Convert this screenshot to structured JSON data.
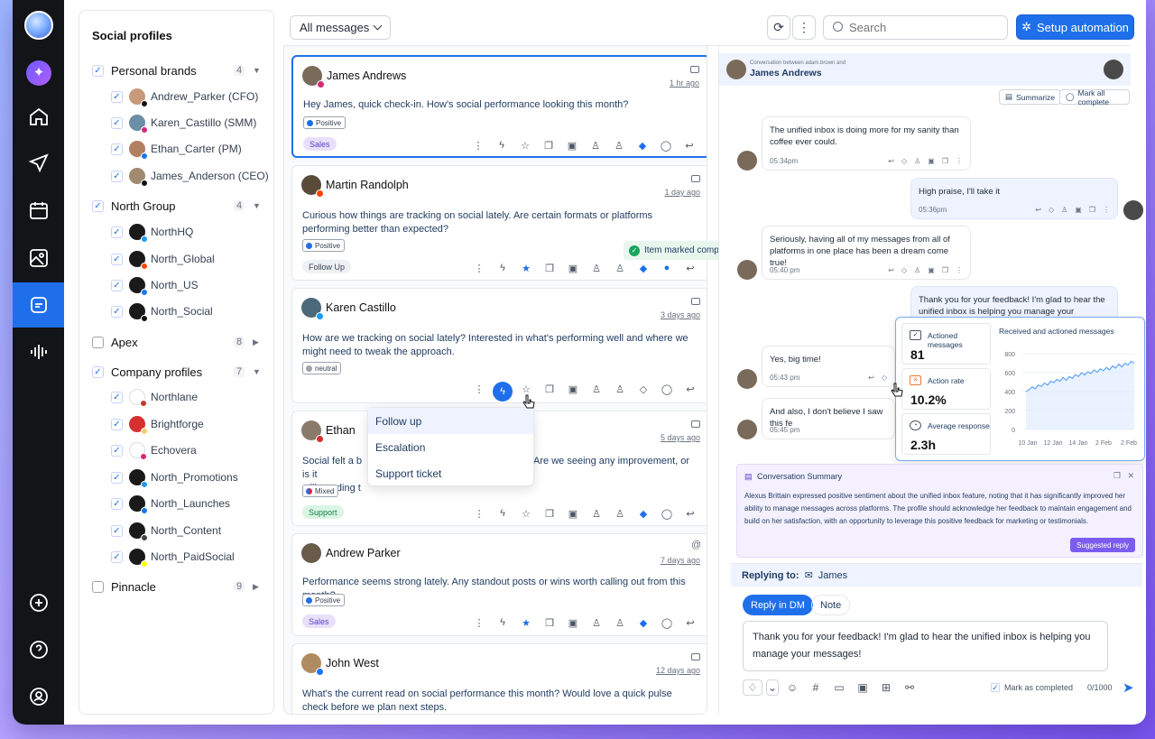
{
  "rail": {
    "nav": [
      "ai-assistant",
      "home",
      "publish",
      "calendar",
      "media",
      "inbox",
      "listening"
    ],
    "active": "inbox",
    "bottom": [
      "add",
      "help",
      "profile"
    ]
  },
  "sidebar": {
    "title": "Social profiles",
    "groups": [
      {
        "name": "Personal brands",
        "count": "4",
        "checked": true,
        "expanded": true,
        "accounts": [
          "Andrew_Parker (CFO)",
          "Karen_Castillo (SMM)",
          "Ethan_Carter (PM)",
          "James_Anderson (CEO)"
        ]
      },
      {
        "name": "North Group",
        "count": "4",
        "checked": true,
        "expanded": true,
        "accounts": [
          "NorthHQ",
          "North_Global",
          "North_US",
          "North_Social"
        ]
      },
      {
        "name": "Apex",
        "count": "8",
        "checked": false,
        "expanded": false,
        "accounts": []
      },
      {
        "name": "Company profiles",
        "count": "7",
        "checked": true,
        "expanded": true,
        "accounts": [
          "Northlane",
          "Brightforge",
          "Echovera",
          "North_Promotions",
          "North_Launches",
          "North_Content",
          "North_PaidSocial"
        ]
      },
      {
        "name": "Pinnacle",
        "count": "9",
        "checked": false,
        "expanded": false,
        "accounts": []
      }
    ]
  },
  "toolbar": {
    "filter": "All messages",
    "search_placeholder": "Search",
    "automation": "Setup automation"
  },
  "messages": [
    {
      "name": "James Andrews",
      "time": "1 hr ago",
      "text": "Hey James, quick check-in. How's social performance looking this month?",
      "sentiment": "Positive",
      "tag": "Sales"
    },
    {
      "name": "Martin Randolph",
      "time": "1 day ago",
      "text": "Curious how things are tracking on social lately. Are certain formats or platforms performing better than expected?",
      "sentiment": "Positive",
      "tag": "Follow Up"
    },
    {
      "name": "Karen Castillo",
      "time": "3 days ago",
      "text": "How are we tracking on social lately? Interested in what's performing well and where we might need to tweak the approach.",
      "sentiment": "neutral",
      "tag": ""
    },
    {
      "name": "Ethan",
      "time": "5 days ago",
      "text": "Social felt a b... Are we seeing any improvement, or is it still trending t...",
      "text_a": "Social felt a b",
      "text_b": "Are we seeing any improvement, or is it",
      "text_c": "still trending t",
      "sentiment": "Mixed",
      "tag": "Support"
    },
    {
      "name": "Andrew Parker",
      "time": "7 days ago",
      "text": "Performance seems strong lately. Any standout posts or wins worth calling out from this month?",
      "sentiment": "Positive",
      "tag": "Sales"
    },
    {
      "name": "John West",
      "time": "12 days ago",
      "text": "What's the current read on social performance this month? Would love a quick pulse check before we plan next steps.",
      "sentiment": "",
      "tag": ""
    }
  ],
  "toast": "Item marked completed",
  "menu": [
    "Follow up",
    "Escalation",
    "Support ticket"
  ],
  "conversation": {
    "header_sub": "Conversation between adam.brown and",
    "header_name": "James Andrews",
    "summarize": "Summarize",
    "mark_all": "Mark all complete",
    "bubbles": [
      {
        "text": "The unified inbox is doing more for my sanity than coffee ever could.",
        "time": "05:34pm",
        "me": false
      },
      {
        "text": "High praise, I'll take it",
        "time": "05:36pm",
        "me": true
      },
      {
        "text": "Seriously, having all of my messages from all of platforms in one place has been a dream come true!",
        "time": "05:40 pm",
        "me": false
      },
      {
        "text": "Thank you for your feedback! I'm glad to hear the unified inbox is helping you manage your messages!",
        "time": "",
        "me": true
      },
      {
        "text": "Yes, big time!",
        "time": "05:43 pm",
        "me": false
      },
      {
        "text": "And also, I don't believe I saw this fe",
        "time": "05:45 pm",
        "me": false
      }
    ]
  },
  "stats": {
    "cards": [
      {
        "label": "Actioned messages",
        "value": "81"
      },
      {
        "label": "Action rate",
        "value": "10.2%"
      },
      {
        "label": "Average response",
        "value": "2.3h"
      }
    ]
  },
  "chart_data": {
    "type": "line",
    "title": "Received and actioned messages",
    "ylim": [
      0,
      800
    ],
    "yticks": [
      "800",
      "600",
      "400",
      "200",
      "0"
    ],
    "xticks": [
      "10 Jan",
      "12 Jan",
      "14 Jan",
      "2 Feb",
      "2 Feb"
    ],
    "series": [
      {
        "values": [
          400,
          420,
          450,
          430,
          470,
          455,
          490,
          470,
          510,
          495,
          530,
          510,
          550,
          520,
          560,
          540,
          580,
          560,
          600,
          575,
          610,
          590,
          630,
          605,
          640,
          620,
          655,
          630,
          670,
          650,
          690,
          660,
          700,
          680,
          720,
          700
        ]
      }
    ],
    "grid": true
  },
  "summary": {
    "title": "Conversation Summary",
    "text": "Alexus Brittain expressed positive sentiment about the unified inbox feature, noting that it has significantly improved her ability to manage messages across platforms. The profile should acknowledge her feedback to maintain engagement and build on her satisfaction, with an opportunity to leverage this positive feedback for marketing or testimonials.",
    "suggested": "Suggested reply"
  },
  "reply": {
    "label": "Replying to:",
    "to": "James",
    "tab_dm": "Reply in DM",
    "tab_note": "Note",
    "draft": "Thank you for your feedback! I'm glad to hear the unified inbox is helping you manage your messages!",
    "mark_complete": "Mark as completed",
    "counter": "0/1000"
  },
  "colors": {
    "accent": "#1f6feb",
    "rail": "#121417"
  }
}
